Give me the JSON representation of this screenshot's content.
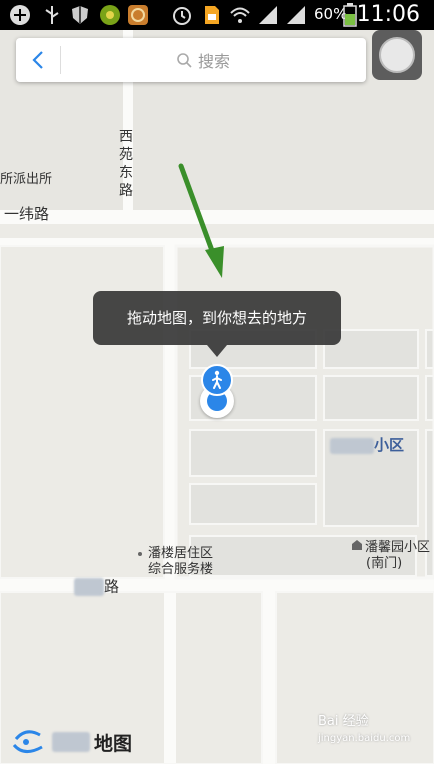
{
  "status_bar": {
    "battery_percent": "60%",
    "time": "11:06",
    "icons": [
      "add-icon",
      "usb-icon",
      "shield-icon",
      "app-icon",
      "app-icon-2",
      "alarm-icon",
      "sim-icon",
      "wifi-icon",
      "signal-icon",
      "battery-icon"
    ]
  },
  "search": {
    "placeholder": "搜索"
  },
  "map": {
    "labels": {
      "road_top_vertical": "西苑东路",
      "police_station": "所派出所",
      "road_weiyi": "一纬路",
      "district_suffix": "小区",
      "service_center_line1": "潘楼居住区",
      "service_center_line2": "综合服务楼",
      "panxinyuan_line1": "潘馨园小区",
      "panxinyuan_line2": "(南门)",
      "road_bottom_suffix": "路"
    }
  },
  "tooltip": {
    "text": "拖动地图，到你想去的地方"
  },
  "logo": {
    "text": "地图"
  },
  "watermark": {
    "line1": "Bai 经验",
    "line2": "jingyan.baidu.com"
  },
  "colors": {
    "accent": "#2b86e8",
    "arrow": "#3a8f2a",
    "map_bg": "#ecebe6",
    "block": "#e2e2de"
  }
}
